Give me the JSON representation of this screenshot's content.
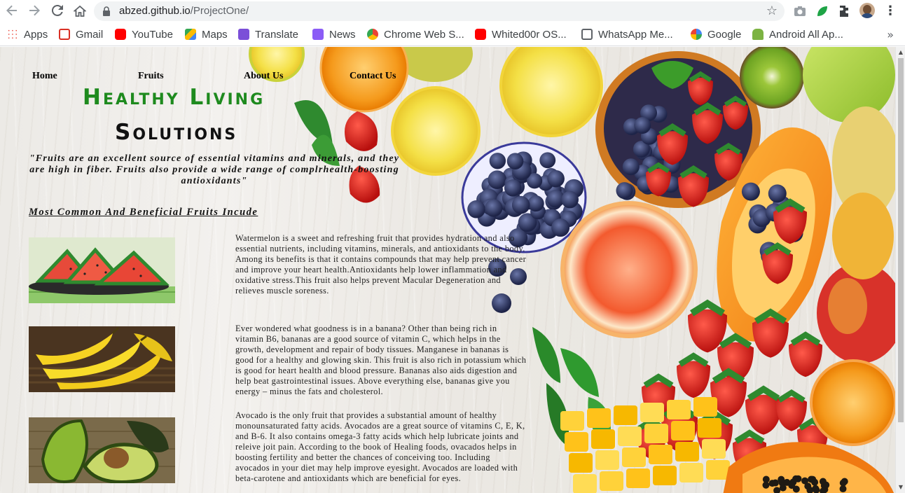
{
  "browser": {
    "url_host": "abzed.github.io",
    "url_path": "/ProjectOne/",
    "bookmarks": [
      {
        "label": "Apps",
        "icon": "apps-grid-icon"
      },
      {
        "label": "Gmail",
        "icon": "gmail-icon"
      },
      {
        "label": "YouTube",
        "icon": "youtube-icon"
      },
      {
        "label": "Maps",
        "icon": "maps-icon"
      },
      {
        "label": "Translate",
        "icon": "translate-icon"
      },
      {
        "label": "News",
        "icon": "news-icon"
      },
      {
        "label": "Chrome Web S...",
        "icon": "chrome-web-store-icon"
      },
      {
        "label": "Whited00r OS...",
        "icon": "youtube-icon"
      },
      {
        "label": "WhatsApp Me...",
        "icon": "page-icon"
      },
      {
        "label": "Google",
        "icon": "google-icon"
      },
      {
        "label": "Android All Ap...",
        "icon": "android-icon"
      }
    ],
    "more_bookmarks": "»"
  },
  "page": {
    "nav": [
      "Home",
      "Fruits",
      "About Us",
      "Contact Us"
    ],
    "brand_line1": "Healthy Living",
    "brand_line2": "Solutions",
    "quote": "\"Fruits are an excellent source of essential vitamins and minerals, and they are high in fiber. Fruits also provide a wide range of complrhealth-boosting antioxidants\"",
    "subheading": "Most Common And Beneficial Fruits Incude",
    "fruits": [
      {
        "name": "watermelon",
        "text": "Watermelon is a sweet and refreshing fruit that provides hydration and also essential nutrients, including vitamins, minerals, and antioxidants to the body. Among its benefits is that it contains compounds that may help prevent cancer and improve your heart health.Antioxidants help lower inflammation and oxidative stress.This fruit also helps prevent Macular Degeneration and relieves muscle soreness."
      },
      {
        "name": "banana",
        "text": "Ever wondered what goodness is in a banana? Other than being rich in vitamin B6, bananas are a good source of vitamin C, which helps in the growth, development and repair of body tissues. Manganese in bananas is good for a healthy and glowing skin. This fruit is also rich in potassium which is good for heart health and blood pressure. Bananas also aids digestion and help beat gastrointestinal issues. Above everything else, bananas give you energy – minus the fats and cholesterol."
      },
      {
        "name": "avocado",
        "text": "Avocado is the only fruit that provides a substantial amount of healthy monounsaturated fatty acids. Avocados are a great source of vitamins C, E, K, and B-6. It also contains omega-3 fatty acids which help lubricate joints and releive joit pain. According to the book of Healing foods, ovacados helps in boosting fertility and better the chances of conceiving too. Including avocados in your diet may help improve eyesight. Avocados are loaded with beta-carotene and antioxidants which are beneficial for eyes."
      }
    ]
  }
}
